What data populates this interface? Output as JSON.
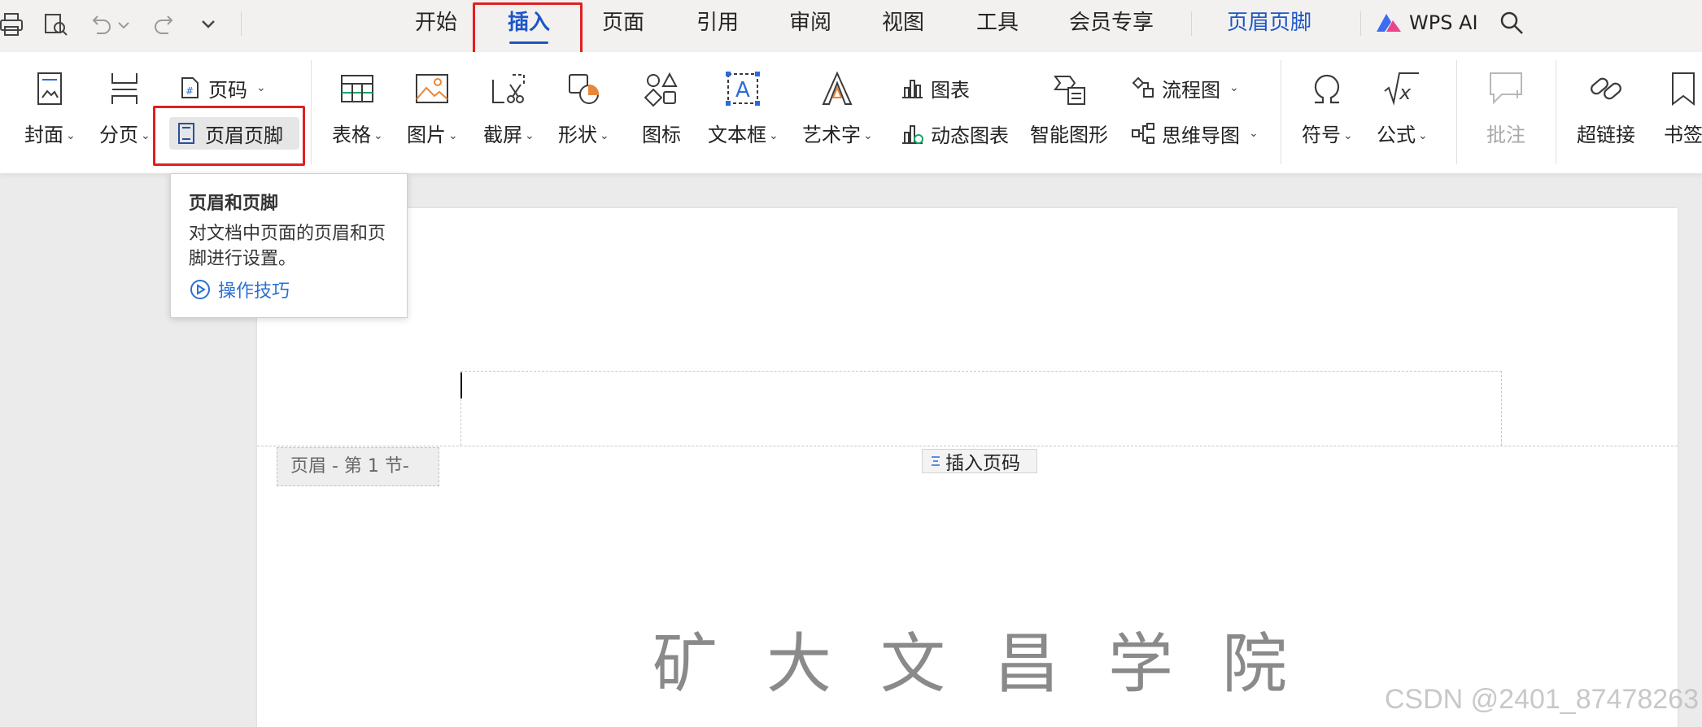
{
  "menubar": {
    "tabs": [
      "开始",
      "插入",
      "页面",
      "引用",
      "审阅",
      "视图",
      "工具",
      "会员专享",
      "页眉页脚"
    ],
    "active_tab": "插入",
    "ai_label": "WPS AI"
  },
  "ribbon": {
    "cover": "封面",
    "page_break": "分页",
    "page_number": "页码",
    "header_footer": "页眉页脚",
    "table": "表格",
    "picture": "图片",
    "screenshot": "截屏",
    "shape": "形状",
    "icon": "图标",
    "textbox": "文本框",
    "wordart": "艺术字",
    "chart": "图表",
    "dynamic_chart": "动态图表",
    "smart_graphic": "智能图形",
    "flowchart": "流程图",
    "mindmap": "思维导图",
    "symbol": "符号",
    "formula": "公式",
    "comment": "批注",
    "hyperlink": "超链接",
    "bookmark": "书签"
  },
  "tooltip": {
    "title": "页眉和页脚",
    "description": "对文档中页面的页眉和页脚进行设置。",
    "link": "操作技巧"
  },
  "document": {
    "header_tag": "页眉 - 第 1 节-",
    "insert_page_number": "插入页码",
    "title_text": "矿大文昌学院"
  },
  "watermark": "CSDN @2401_87478263",
  "colors": {
    "accent": "#1d56c8",
    "highlight_box": "#e02020",
    "link": "#2b6fd6"
  }
}
